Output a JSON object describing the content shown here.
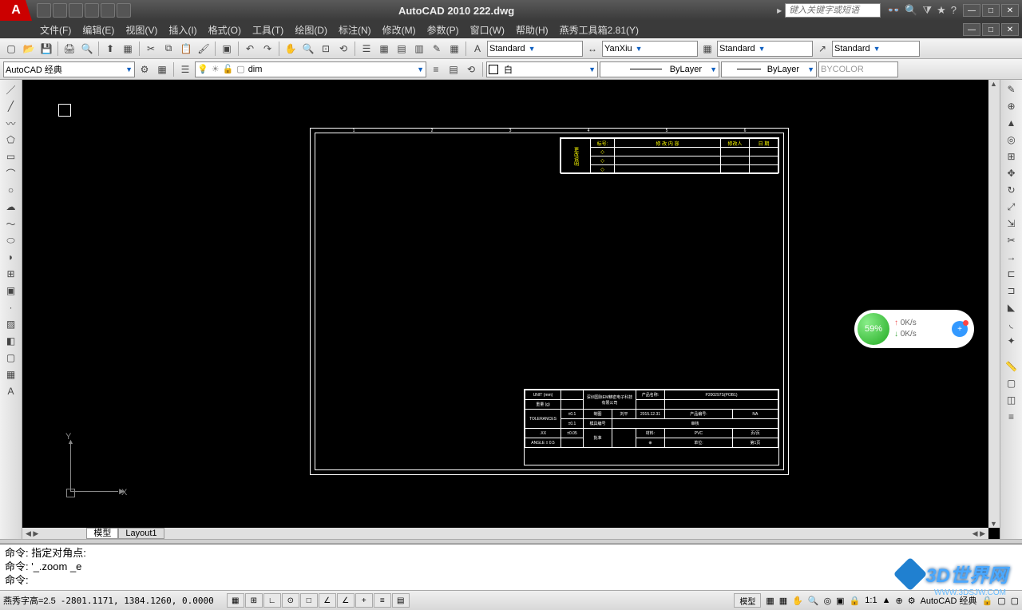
{
  "app": {
    "title": "AutoCAD 2010   222.dwg",
    "search_placeholder": "键入关键字或短语"
  },
  "menu": {
    "file": "文件(F)",
    "edit": "编辑(E)",
    "view": "视图(V)",
    "insert": "插入(I)",
    "format": "格式(O)",
    "tools": "工具(T)",
    "draw": "绘图(D)",
    "dimension": "标注(N)",
    "modify": "修改(M)",
    "params": "参数(P)",
    "window": "窗口(W)",
    "help": "帮助(H)",
    "yanxiu": "燕秀工具箱2.81(Y)"
  },
  "workspaces": {
    "current": "AutoCAD 经典"
  },
  "styles": {
    "text_style": "Standard",
    "dim_style": "YanXiu",
    "table_style": "Standard",
    "mleader_style": "Standard"
  },
  "layer": {
    "current": "dim"
  },
  "props": {
    "color_label": "白",
    "linetype": "ByLayer",
    "lineweight": "ByLayer",
    "plotstyle": "BYCOLOR"
  },
  "tabs": {
    "model": "模型",
    "layout1": "Layout1"
  },
  "ucs": {
    "x": "X",
    "y": "Y"
  },
  "rev_table": {
    "col_tag": "更改说明",
    "col_mark": "标号:",
    "col_desc": "修 改 内 容",
    "col_by": "修改人",
    "col_date": "日 期"
  },
  "title_block": {
    "unit": "UNIT (mm)",
    "company_cn": "深圳国际EM精密电子科技有限公司",
    "prod_name_lbl": "产品名称:",
    "prod_name": "",
    "weight": "重量 (g)",
    "drawn": "制图",
    "date": "2015.12.31",
    "prod_code_lbl": "产品编号:",
    "prod_code": "NA",
    "tolerances": "TOLERANCES",
    "drawing_no": "模具编号",
    "check": "审核",
    "approve": "批准",
    "material_lbl": "材料:",
    "material": "PVC",
    "page_lbl": "页/页",
    "angle": "ANGLE ± 0.5",
    "unit2": "单位:",
    "page": "第1页"
  },
  "cmd": {
    "line1": "命令: 指定对角点:",
    "line2": "命令: '_.zoom _e",
    "prompt": "命令:"
  },
  "status": {
    "yanxiu_height": "燕秀字高=2.5",
    "coords": "-2801.1171, 1384.1260, 0.0000",
    "model_btn": "模型",
    "scale": "1:1",
    "ws_label": "AutoCAD 经典"
  },
  "widget": {
    "pct": "59%",
    "up": "0K/s",
    "down": "0K/s"
  },
  "watermark": {
    "text": "3D世界网",
    "url": "WWW.3DSJW.COM"
  }
}
